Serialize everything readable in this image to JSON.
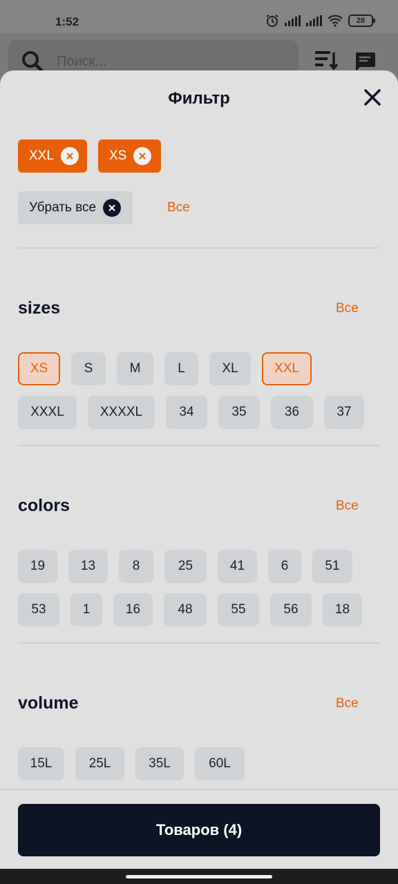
{
  "status": {
    "time": "1:52",
    "battery": "28"
  },
  "background": {
    "search_placeholder": "Поиск..."
  },
  "sheet": {
    "title": "Фильтр",
    "selected_chips": [
      {
        "label": "XXL"
      },
      {
        "label": "XS"
      }
    ],
    "clear_all": "Убрать все",
    "all_link": "Все"
  },
  "sections": {
    "sizes": {
      "title": "sizes",
      "all_link": "Все",
      "options": [
        "XS",
        "S",
        "M",
        "L",
        "XL",
        "XXL",
        "XXXL",
        "XXXXL",
        "34",
        "35",
        "36",
        "37"
      ],
      "selected": [
        "XS",
        "XXL"
      ]
    },
    "colors": {
      "title": "colors",
      "all_link": "Все",
      "options": [
        "19",
        "13",
        "8",
        "25",
        "41",
        "6",
        "51",
        "53",
        "1",
        "16",
        "48",
        "55",
        "56",
        "18"
      ]
    },
    "volume": {
      "title": "volume",
      "all_link": "Все",
      "options": [
        "15L",
        "25L",
        "35L",
        "60L"
      ]
    }
  },
  "footer": {
    "button_label": "Товаров (4)"
  },
  "colors": {
    "accent": "#e85f0a",
    "chip_bg": "#cfd3d6",
    "dark": "#0c1426",
    "sheet_bg": "#e0e0e0"
  }
}
